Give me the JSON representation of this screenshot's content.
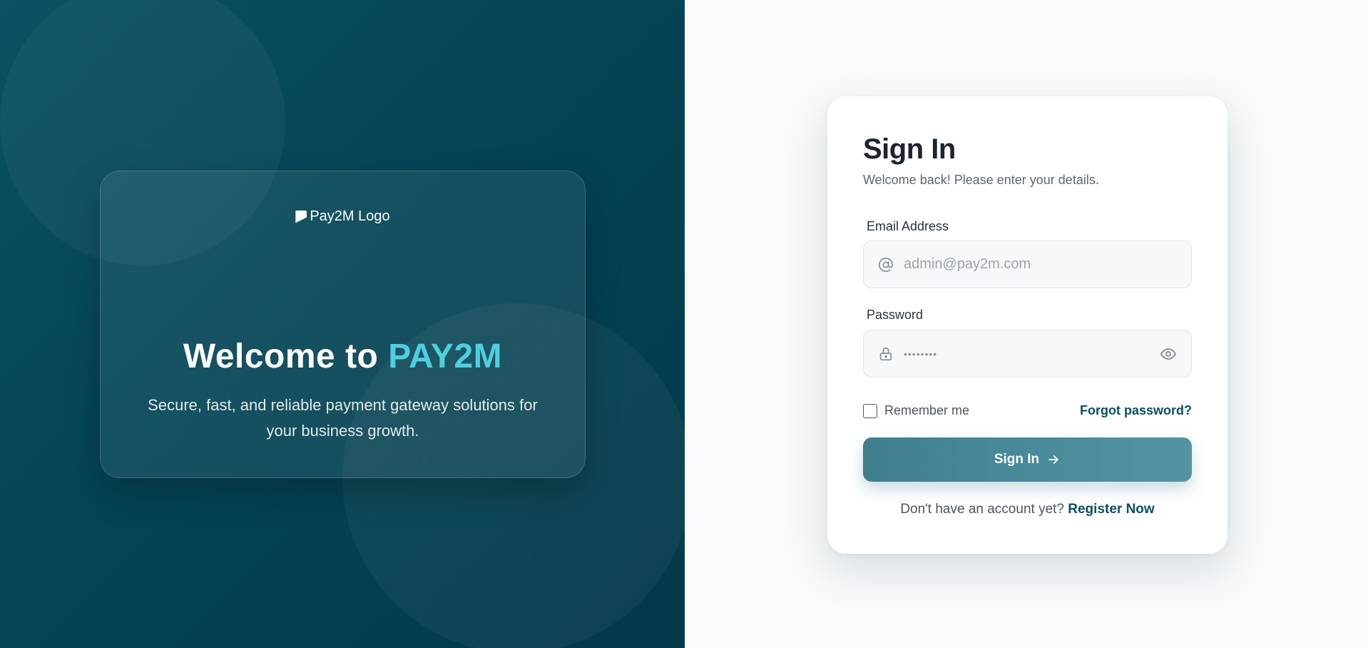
{
  "hero": {
    "logo_alt": "Pay2M Logo",
    "welcome_prefix": "Welcome to ",
    "brand_name": "PAY2M",
    "subtitle": "Secure, fast, and reliable payment gateway solutions for your business growth."
  },
  "signin": {
    "title": "Sign In",
    "subtitle": "Welcome back! Please enter your details.",
    "email_label": "Email Address",
    "email_placeholder": "admin@pay2m.com",
    "email_icon": "at-icon",
    "password_label": "Password",
    "password_value": "••••••••",
    "password_icon": "lock-icon",
    "show_password_icon": "eye-icon",
    "remember_label": "Remember me",
    "remember_checked": false,
    "forgot_label": "Forgot password?",
    "button_label": "Sign In",
    "button_icon": "arrow-right-icon",
    "register_prompt": "Don't have an account yet?",
    "register_link": "Register Now"
  },
  "colors": {
    "brand_dark": "#0a5163",
    "brand_accent": "#4dcfe0",
    "button": "#4a8a99"
  }
}
